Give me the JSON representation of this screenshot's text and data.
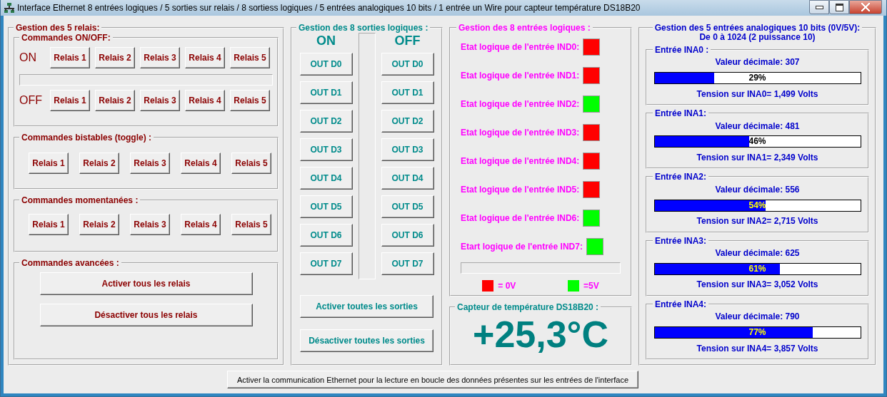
{
  "window": {
    "title": "Interface Ethernet 8 entrées logiques / 5 sorties sur relais / 8 sortiess logiques / 5 entrées analogiques 10 bits / 1 entrée un Wire pour capteur température DS18B20"
  },
  "relays": {
    "title": "Gestion des 5 relais:",
    "on_off": {
      "title": "Commandes ON/OFF:",
      "rows": [
        {
          "label": "ON",
          "buttons": [
            "Relais 1",
            "Relais 2",
            "Relais 3",
            "Relais 4",
            "Relais 5"
          ]
        },
        {
          "label": "OFF",
          "buttons": [
            "Relais 1",
            "Relais 2",
            "Relais 3",
            "Relais 4",
            "Relais 5"
          ]
        }
      ]
    },
    "toggle": {
      "title": "Commandes bistables (toggle) :",
      "buttons": [
        "Relais 1",
        "Relais 2",
        "Relais 3",
        "Relais 4",
        "Relais 5"
      ]
    },
    "momentary": {
      "title": "Commandes momentanées :",
      "buttons": [
        "Relais 1",
        "Relais 2",
        "Relais 3",
        "Relais 4",
        "Relais 5"
      ]
    },
    "advanced": {
      "title": "Commandes avancées :",
      "buttons": [
        "Activer tous les relais",
        "Désactiver tous les relais"
      ]
    }
  },
  "outputs": {
    "title": "Gestion des 8 sorties logiques :",
    "columns": [
      {
        "heading": "ON",
        "buttons": [
          "OUT D0",
          "OUT D1",
          "OUT D2",
          "OUT D3",
          "OUT D4",
          "OUT D5",
          "OUT D6",
          "OUT D7"
        ]
      },
      {
        "heading": "OFF",
        "buttons": [
          "OUT D0",
          "OUT D1",
          "OUT D2",
          "OUT D3",
          "OUT D4",
          "OUT D5",
          "OUT D6",
          "OUT D7"
        ]
      }
    ],
    "buttons": [
      "Activer toutes les sorties",
      "Désactiver toutes les sorties"
    ]
  },
  "logic_inputs": {
    "title": "Gestion des 8 entrées logiques :",
    "inputs": [
      {
        "label": "Etat logique de l'entrée IND0:",
        "high": false
      },
      {
        "label": "Etat logique de l'entrée IND1:",
        "high": false
      },
      {
        "label": "Etat logique de l'entrée IND2:",
        "high": true
      },
      {
        "label": "Etat logique de l'entrée IND3:",
        "high": false
      },
      {
        "label": "Etat logique de l'entrée IND4:",
        "high": false
      },
      {
        "label": "Etat logique de l'entrée IND5:",
        "high": false
      },
      {
        "label": "Etat logique de l'entrée IND6:",
        "high": true
      },
      {
        "label": "Etart logique de l'entrée IND7:",
        "high": true
      }
    ],
    "legend": [
      {
        "color": "#ff0000",
        "label": "= 0V"
      },
      {
        "color": "#00ff00",
        "label": "=5V"
      }
    ]
  },
  "temperature": {
    "title": "Capteur de température DS18B20 :",
    "value": "+25,3°C"
  },
  "analog": {
    "title": "Gestion des 5 entrées analogiques 10 bits (0V/5V):",
    "subtitle": "De 0 à 1024 (2 puissance 10)",
    "channels": [
      {
        "title": "Entrée INA0 :",
        "decimal": "Valeur décimale: 307",
        "level": 0.29,
        "percent": "29%",
        "voltage": "Tension sur INA0= 1,499 Volts"
      },
      {
        "title": "Entrée INA1:",
        "decimal": "Valeur décimale: 481",
        "level": 0.46,
        "percent": "46%",
        "voltage": "Tension sur INA1= 2,349 Volts"
      },
      {
        "title": "Entrée INA2:",
        "decimal": "Valeur décimale: 556",
        "level": 0.54,
        "percent": "54%",
        "voltage": "Tension sur INA2= 2,715 Volts"
      },
      {
        "title": "Entrée INA3:",
        "decimal": "Valeur décimale: 625",
        "level": 0.61,
        "percent": "61%",
        "voltage": "Tension sur INA3= 3,052 Volts"
      },
      {
        "title": "Entrée INA4:",
        "decimal": "Valeur décimale: 790",
        "level": 0.77,
        "percent": "77%",
        "voltage": "Tension sur INA4= 3,857 Volts"
      }
    ]
  },
  "footer_button": "Activer la communication Ethernet pour la lecture en boucle des données présentes sur les entrées de l'interface"
}
